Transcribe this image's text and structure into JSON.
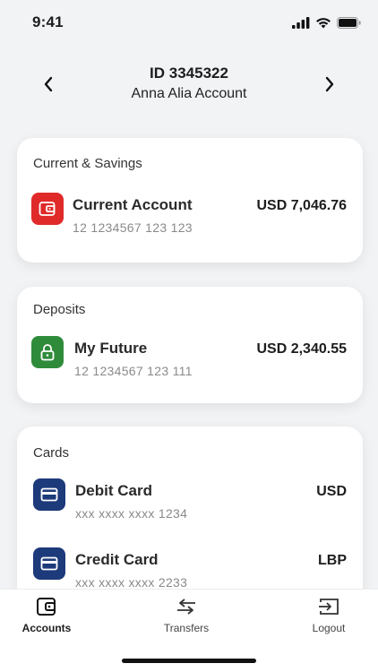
{
  "status_bar": {
    "time": "9:41"
  },
  "header": {
    "id": "ID 3345322",
    "account_name": "Anna Alia Account"
  },
  "sections": [
    {
      "title": "Current & Savings",
      "accounts": [
        {
          "name": "Current Account",
          "number": "12 1234567 123 123",
          "amount": "USD 7,046.76",
          "icon": "wallet-icon",
          "color": "#e02a2a"
        }
      ]
    },
    {
      "title": "Deposits",
      "accounts": [
        {
          "name": "My Future",
          "number": "12 1234567 123 111",
          "amount": "USD 2,340.55",
          "icon": "lock-icon",
          "color": "#2e8b3a"
        }
      ]
    },
    {
      "title": "Cards",
      "accounts": [
        {
          "name": "Debit Card",
          "number": "xxx xxxx xxxx 1234",
          "amount": "USD",
          "icon": "credit-card-icon",
          "color": "#1d3a7a"
        },
        {
          "name": "Credit Card",
          "number": "xxx xxxx xxxx 2233",
          "amount": "LBP",
          "icon": "credit-card-icon",
          "color": "#1d3a7a"
        }
      ]
    }
  ],
  "tab_bar": {
    "tabs": [
      {
        "label": "Accounts",
        "icon": "wallet-icon",
        "active": true
      },
      {
        "label": "Transfers",
        "icon": "transfer-arrows-icon",
        "active": false
      },
      {
        "label": "Logout",
        "icon": "logout-icon",
        "active": false
      }
    ]
  }
}
